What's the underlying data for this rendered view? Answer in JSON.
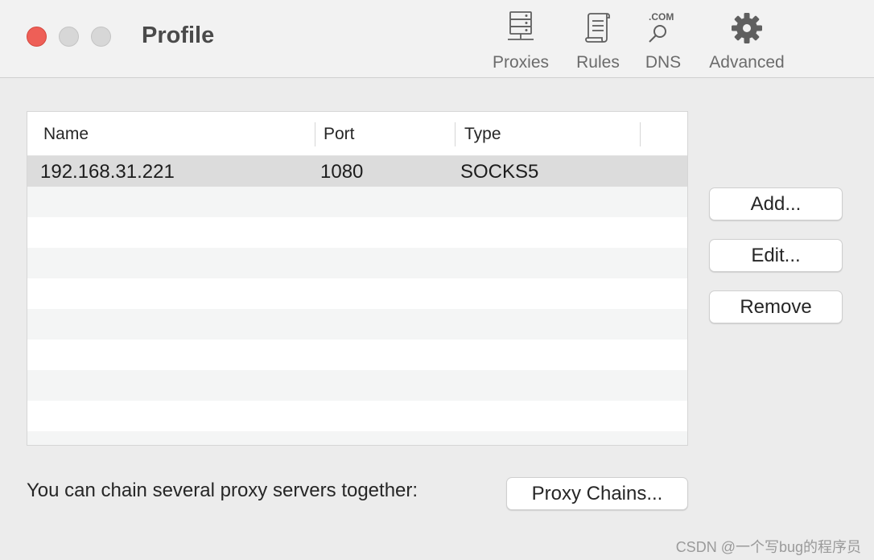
{
  "window": {
    "title": "Profile"
  },
  "toolbar": {
    "items": [
      {
        "label": "Proxies",
        "icon": "server-icon"
      },
      {
        "label": "Rules",
        "icon": "scroll-icon"
      },
      {
        "label": "DNS",
        "icon": "dns-magnifier-icon",
        "icon_text": ".COM"
      },
      {
        "label": "Advanced",
        "icon": "gear-icon"
      }
    ]
  },
  "table": {
    "columns": [
      "Name",
      "Port",
      "Type"
    ],
    "rows": [
      {
        "name": "192.168.31.221",
        "port": "1080",
        "type": "SOCKS5",
        "selected": true
      }
    ]
  },
  "buttons": {
    "add": "Add...",
    "edit": "Edit...",
    "remove": "Remove",
    "proxy_chains": "Proxy Chains..."
  },
  "footer": {
    "chain_text": "You can chain several proxy servers together:"
  },
  "watermark": "CSDN @一个写bug的程序员",
  "colors": {
    "close": "#ee5f57",
    "selected_row": "#dcdcdc",
    "alt_row": "#f4f5f5"
  }
}
